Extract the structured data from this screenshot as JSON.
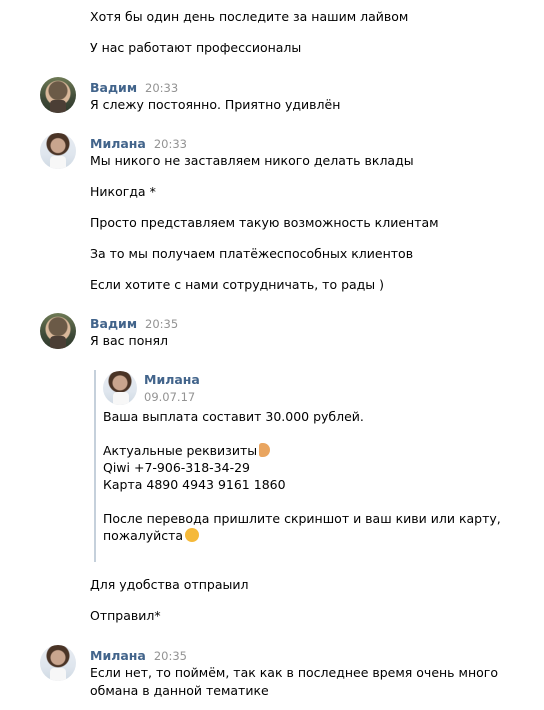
{
  "top_messages": [
    "Хотя бы один день последите за нашим лайвом",
    "У нас работают профессионалы"
  ],
  "block1": {
    "name": "Вадим",
    "time": "20:33",
    "lines": [
      "Я слежу постоянно. Приятно удивлён"
    ]
  },
  "block2": {
    "name": "Милана",
    "time": "20:33",
    "lines": [
      "Мы никого не заставляем никого делать вклады",
      "Никогда *",
      "Просто представляем такую возможность клиентам",
      "За то мы получаем платёжеспособных клиентов",
      "Если хотите с нами сотрудничать, то рады )"
    ]
  },
  "block3": {
    "name": "Вадим",
    "time": "20:35",
    "lines": [
      "Я вас понял"
    ],
    "quote": {
      "name": "Милана",
      "date": "09.07.17",
      "line1": "Ваша выплата составит 30.000 рублей.",
      "line2": "Актуальные реквизиты",
      "line3": "Qiwi +7-906-318-34-29",
      "line4": "Карта 4890 4943 9161 1860",
      "line5": "После перевода пришлите скриншот и ваш киви или карту,",
      "line6": "пожалуйста",
      "emoji1": "hand-pointing-icon",
      "emoji2": "wink-emoji-icon"
    },
    "after_lines": [
      "Для удобства отпраыил",
      "Отправил*"
    ]
  },
  "block4": {
    "name": "Милана",
    "time": "20:35",
    "lines": [
      "Если нет, то поймём, так как в последнее время очень много",
      "обмана в данной тематике"
    ]
  }
}
